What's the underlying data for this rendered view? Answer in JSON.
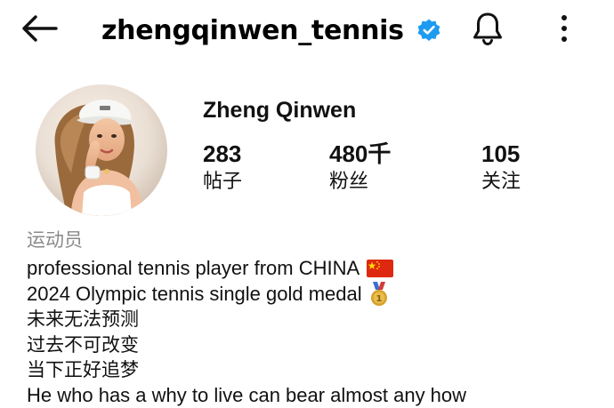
{
  "header": {
    "username": "zhengqinwen_tennis",
    "verified": true,
    "icons": {
      "back": "back-arrow-icon",
      "verified": "verified-badge-icon",
      "bell": "bell-icon",
      "more": "more-vertical-icon"
    }
  },
  "profile": {
    "display_name": "Zheng Qinwen",
    "stats": [
      {
        "value": "283",
        "label": "帖子"
      },
      {
        "value": "480千",
        "label": "粉丝"
      },
      {
        "value": "105",
        "label": "关注"
      }
    ]
  },
  "bio": {
    "category": "运动员",
    "lines": [
      "professional tennis player from CHINA",
      "2024 Olympic tennis single gold medal",
      "未来无法预测",
      "过去不可改变",
      "当下正好追梦",
      "He who has a why to live can bear almost any how"
    ],
    "line1_emoji": "china-flag-icon",
    "line2_emoji": "gold-medal-icon"
  },
  "colors": {
    "verified_blue": "#1d9bf0",
    "muted_text": "#8a8a8a",
    "flag_red": "#de2910",
    "flag_star": "#ffde00",
    "medal_gold": "#d4a12a"
  }
}
